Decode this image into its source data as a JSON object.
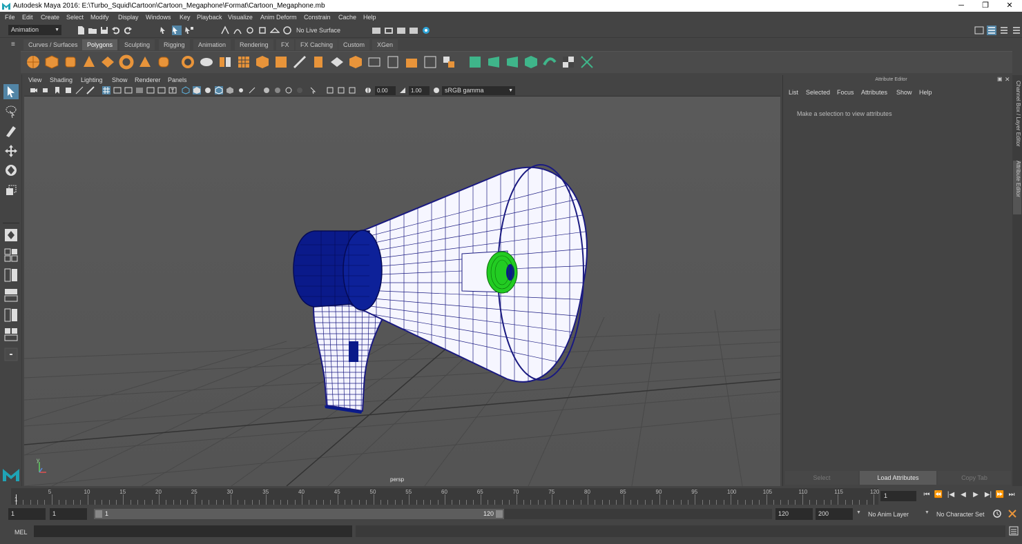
{
  "window": {
    "title": "Autodesk Maya 2016: E:\\Turbo_Squid\\Cartoon\\Cartoon_Megaphone\\Format\\Cartoon_Megaphone.mb",
    "min": "─",
    "max": "❐",
    "close": "✕"
  },
  "menubar": [
    "File",
    "Edit",
    "Create",
    "Select",
    "Modify",
    "Display",
    "Windows",
    "Key",
    "Playback",
    "Visualize",
    "Anim Deform",
    "Constrain",
    "Cache",
    "Help"
  ],
  "statusline": {
    "menuset": "Animation",
    "live_surface": "No Live Surface"
  },
  "shelf_tabs": [
    "Curves / Surfaces",
    "Polygons",
    "Sculpting",
    "Rigging",
    "Animation",
    "Rendering",
    "FX",
    "FX Caching",
    "Custom",
    "XGen"
  ],
  "shelf_active": "Polygons",
  "viewport": {
    "menus": [
      "View",
      "Shading",
      "Lighting",
      "Show",
      "Renderer",
      "Panels"
    ],
    "exposure": "0.00",
    "gamma": "1.00",
    "color_space": "sRGB gamma",
    "camera_label": "persp",
    "axis_y": "y"
  },
  "attribute_editor": {
    "title": "Attribute Editor",
    "menus": [
      "List",
      "Selected",
      "Focus",
      "Attributes",
      "Show",
      "Help"
    ],
    "message": "Make a selection to view attributes",
    "buttons": [
      "Select",
      "Load Attributes",
      "Copy Tab"
    ]
  },
  "side_tabs": [
    "Channel Box / Layer Editor",
    "Attribute Editor"
  ],
  "timeline": {
    "ticks": [
      "5",
      "10",
      "15",
      "20",
      "25",
      "30",
      "35",
      "40",
      "45",
      "50",
      "55",
      "60",
      "65",
      "70",
      "75",
      "80",
      "85",
      "90",
      "95",
      "100",
      "105",
      "110",
      "115",
      "120"
    ],
    "start_marker": "1",
    "current_frame": "1",
    "playback": [
      "⏮",
      "⏪",
      "|◀",
      "◀",
      "▶",
      "▶|",
      "⏩",
      "⏭"
    ]
  },
  "range": {
    "start_field": "1",
    "playback_start": "1",
    "slider_start": "1",
    "slider_end": "120",
    "playback_end": "120",
    "end_field": "200",
    "anim_layer": "No Anim Layer",
    "character_set": "No Character Set"
  },
  "cmdline": {
    "label": "MEL"
  },
  "colors": {
    "mesh_blue": "#0a1a8a",
    "speaker_green": "#22cc22",
    "wire": "#1a1a80"
  }
}
